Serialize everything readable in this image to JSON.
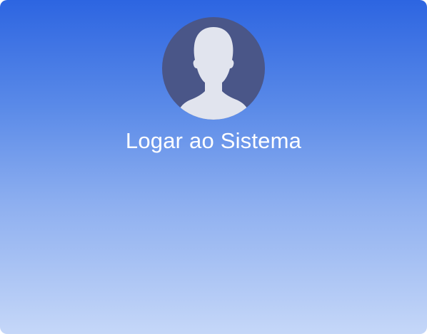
{
  "login": {
    "avatar_icon": "user-silhouette-icon",
    "title": "Logar ao Sistema"
  },
  "colors": {
    "gradient_top": "#2d65e1",
    "gradient_bottom": "#c5d7f8",
    "avatar_bg": "#4a5688",
    "silhouette": "#e1e4ee",
    "title_text": "#ffffff"
  }
}
